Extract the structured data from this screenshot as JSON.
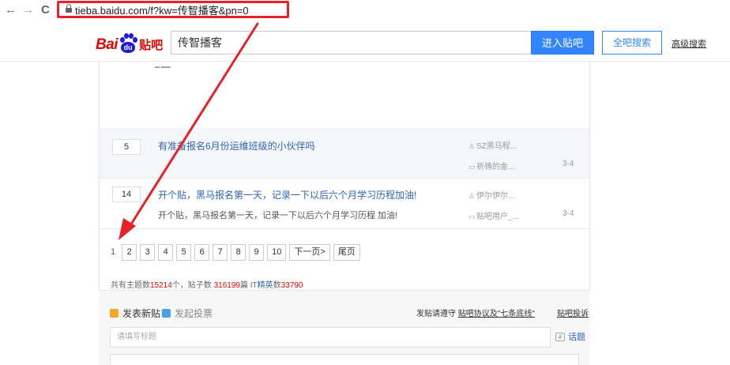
{
  "browser": {
    "back": "←",
    "forward": "→",
    "reload": "C",
    "url": "tieba.baidu.com/f?kw=传智播客&pn=0"
  },
  "header": {
    "logo_bai": "Bai",
    "logo_du": "du",
    "logo_tieba": "贴吧",
    "search_value": "传智播客",
    "enter_button": "进入贴吧",
    "all_search_button": "全吧搜索",
    "advanced_search": "高级搜索"
  },
  "threads": [
    {
      "replies": "5",
      "title": "有准备报名6月份运维班级的小伙伴吗",
      "abstract": "",
      "author": "SZ黑马程...",
      "last_reply": "祈祷的金...",
      "time": "3-4"
    },
    {
      "replies": "14",
      "title": "开个贴，黑马报名第一天，记录一下以后六个月学习历程加油!",
      "abstract": "开个贴，黑马报名第一天，记录一下以后六个月学习历程 加油!",
      "author": "伊尔伊尔...",
      "last_reply": "贴吧用户_...",
      "time": "3-4"
    }
  ],
  "pagination": {
    "current": "1",
    "pages": [
      "2",
      "3",
      "4",
      "5",
      "6",
      "7",
      "8",
      "9",
      "10"
    ],
    "next": "下一页>",
    "last": "尾页"
  },
  "stats": {
    "prefix": "共有主题数",
    "topics": "15214",
    "mid1": "个，贴子数 ",
    "posts": "316199",
    "mid2": "篇 IT",
    "fans_label": "精英",
    "mid3": "数",
    "fans": "33790"
  },
  "editor": {
    "new_post": "发表新贴",
    "new_vote": "发起投票",
    "rule_prefix": "发贴请遵守 ",
    "rule_link": "贴吧协议及\"七条底线\"",
    "report": "贴吧投诉",
    "title_placeholder": "请填写标题",
    "topic": "话题"
  },
  "colors": {
    "accent": "#3385ff",
    "link": "#2d64b3",
    "annotation": "#e8202a"
  }
}
